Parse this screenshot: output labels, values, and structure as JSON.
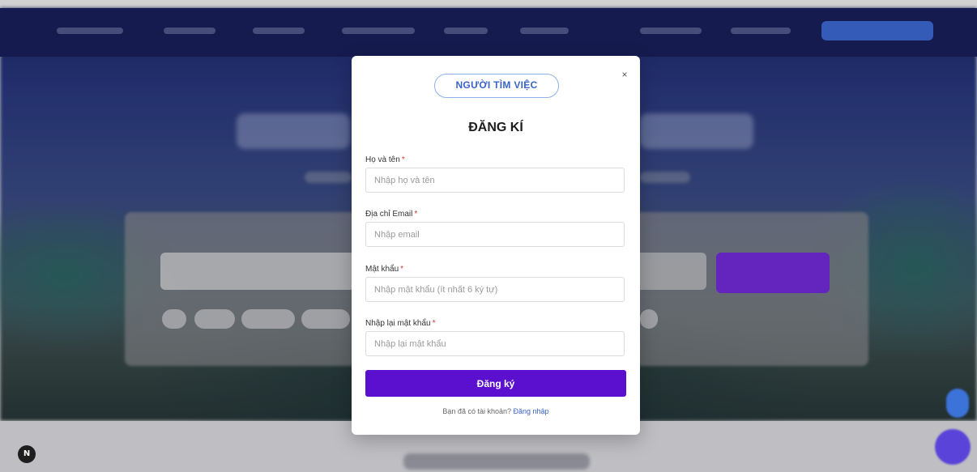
{
  "modal": {
    "role_tab": "NGƯỜI TÌM VIỆC",
    "close_symbol": "×",
    "title": "ĐĂNG KÍ",
    "fields": [
      {
        "label": "Họ và tên",
        "required_mark": "*",
        "placeholder": "Nhập họ và tên"
      },
      {
        "label": "Địa chỉ Email",
        "required_mark": "*",
        "placeholder": "Nhập email"
      },
      {
        "label": "Mật khẩu",
        "required_mark": "*",
        "placeholder": "Nhập mật khẩu (ít nhất 6 ký tự)"
      },
      {
        "label": "Nhập lại mật khẩu",
        "required_mark": "*",
        "placeholder": "Nhập lại mật khẩu"
      }
    ],
    "submit_label": "Đăng ký",
    "login_prompt": "Bạn đã có tài khoản?",
    "login_link": "Đăng nhập"
  },
  "corner_badge": "N",
  "colors": {
    "primary": "#5b0fcf",
    "link": "#3a63c9",
    "hero_bg": "#1f2a6b",
    "overlay": "rgba(0,0,0,0.18)"
  },
  "icons": {
    "close": "close-icon",
    "corner": "notion-badge-icon"
  }
}
